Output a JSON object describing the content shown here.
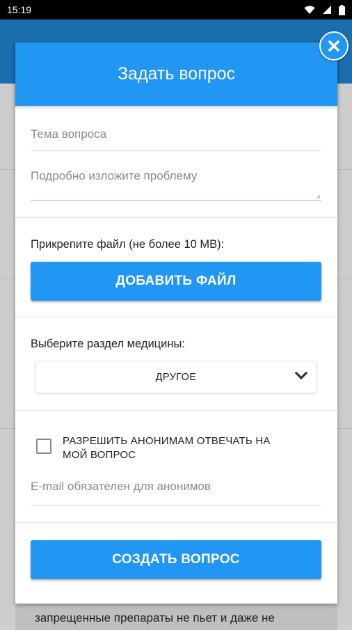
{
  "status_bar": {
    "time": "15:19"
  },
  "background": {
    "text_line": "запрещенные препараты не пьет и даже не"
  },
  "dialog": {
    "title": "Задать вопрос",
    "topic_placeholder": "Тема вопроса",
    "details_placeholder": "Подробно изложите проблему",
    "attach_label": "Прикрепите файл (не более 10 MB):",
    "add_file_button": "ДОБАВИТЬ ФАЙЛ",
    "section_label": "Выберите раздел медицины:",
    "section_selected": "ДРУГОЕ",
    "anonymous_checkbox_label": "РАЗРЕШИТЬ АНОНИМАМ ОТВЕЧАТЬ НА МОЙ ВОПРОС",
    "anonymous_checked": false,
    "email_placeholder": "E-mail обязателен для анонимов",
    "create_button": "СОЗДАТЬ ВОПРОС"
  },
  "colors": {
    "accent": "#2196f3",
    "status_bar": "#000000"
  },
  "icons": {
    "close": "close-icon",
    "dropdown": "chevron-down-icon",
    "wifi": "wifi-icon",
    "signal": "signal-icon",
    "battery": "battery-icon"
  }
}
